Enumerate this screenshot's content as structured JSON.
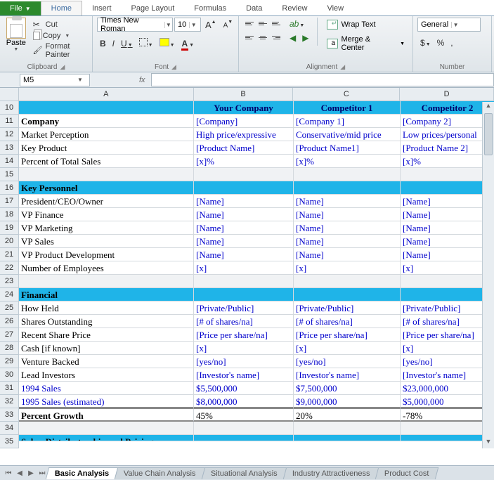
{
  "tabs": {
    "file": "File",
    "list": [
      "Home",
      "Insert",
      "Page Layout",
      "Formulas",
      "Data",
      "Review",
      "View"
    ],
    "active": 0
  },
  "clipboard": {
    "paste": "Paste",
    "cut": "Cut",
    "copy": "Copy",
    "painter": "Format Painter",
    "group": "Clipboard"
  },
  "font": {
    "name": "Times New Roman",
    "size": "10",
    "group": "Font",
    "btns": {
      "grow": "A",
      "shrink": "A",
      "bold": "B",
      "italic": "I",
      "underline": "U",
      "fontcolor": "A"
    }
  },
  "alignment": {
    "group": "Alignment",
    "wrap": "Wrap Text",
    "merge": "Merge & Center"
  },
  "number": {
    "group": "Number",
    "format": "General",
    "currency": "$",
    "percent": "%",
    "comma": ",",
    "inc": "",
    "dec": ""
  },
  "namebox": "M5",
  "fx": "fx",
  "columns": [
    "A",
    "B",
    "C",
    "D"
  ],
  "rowStart": 10,
  "headers": {
    "A": "",
    "B": "Your Company",
    "C": "Competitor 1",
    "D": "Competitor 2"
  },
  "rows": [
    {
      "n": 11,
      "type": "data",
      "bold": true,
      "a": "Company",
      "b": "[Company]",
      "c": "[Company 1]",
      "d": "[Company 2]"
    },
    {
      "n": 12,
      "type": "data",
      "a": "Market Perception",
      "b": "High price/expressive",
      "c": "Conservative/mid price",
      "d": "Low prices/personal"
    },
    {
      "n": 13,
      "type": "data",
      "a": "Key Product",
      "b": "[Product Name]",
      "c": "[Product Name1]",
      "d": "[Product Name 2]"
    },
    {
      "n": 14,
      "type": "data",
      "a": "Percent of Total Sales",
      "b": "[x]%",
      "c": "[x]%",
      "d": "[x]%"
    },
    {
      "n": 15,
      "type": "blank"
    },
    {
      "n": 16,
      "type": "section",
      "a": "Key Personnel"
    },
    {
      "n": 17,
      "type": "data",
      "a": "President/CEO/Owner",
      "b": "[Name]",
      "c": "[Name]",
      "d": "[Name]"
    },
    {
      "n": 18,
      "type": "data",
      "a": "VP Finance",
      "b": "[Name]",
      "c": "[Name]",
      "d": "[Name]"
    },
    {
      "n": 19,
      "type": "data",
      "a": "VP Marketing",
      "b": "[Name]",
      "c": "[Name]",
      "d": "[Name]"
    },
    {
      "n": 20,
      "type": "data",
      "a": "VP Sales",
      "b": "[Name]",
      "c": "[Name]",
      "d": "[Name]"
    },
    {
      "n": 21,
      "type": "data",
      "a": "VP Product Development",
      "b": "[Name]",
      "c": "[Name]",
      "d": "[Name]"
    },
    {
      "n": 22,
      "type": "data",
      "a": "Number of Employees",
      "b": "[x]",
      "c": "[x]",
      "d": "[x]"
    },
    {
      "n": 23,
      "type": "blank"
    },
    {
      "n": 24,
      "type": "section",
      "a": "Financial"
    },
    {
      "n": 25,
      "type": "data",
      "a": "How Held",
      "b": "[Private/Public]",
      "c": "[Private/Public]",
      "d": "[Private/Public]"
    },
    {
      "n": 26,
      "type": "data",
      "a": "Shares Outstanding",
      "b": "[# of shares/na]",
      "c": "[# of shares/na]",
      "d": "[# of shares/na]"
    },
    {
      "n": 27,
      "type": "data",
      "a": "Recent Share Price",
      "b": "[Price per share/na]",
      "c": "[Price per share/na]",
      "d": "[Price per share/na]"
    },
    {
      "n": 28,
      "type": "data",
      "a": "Cash [if known]",
      "b": "[x]",
      "c": "[x]",
      "d": "[x]"
    },
    {
      "n": 29,
      "type": "data",
      "a": "Venture Backed",
      "b": "[yes/no]",
      "c": "[yes/no]",
      "d": "[yes/no]"
    },
    {
      "n": 30,
      "type": "data",
      "a": "Lead Investors",
      "b": "[Investor's name]",
      "c": "[Investor's name]",
      "d": "[Investor's name]"
    },
    {
      "n": 31,
      "type": "data",
      "link": true,
      "a": "1994 Sales",
      "b": "$5,500,000",
      "c": "$7,500,000",
      "d": "$23,000,000"
    },
    {
      "n": 32,
      "type": "data",
      "link": true,
      "a": "1995 Sales (estimated)",
      "b": "$8,000,000",
      "c": "$9,000,000",
      "d": "$5,000,000",
      "bottomthick": true
    },
    {
      "n": 33,
      "type": "data",
      "bold": true,
      "a": "Percent Growth",
      "b": "45%",
      "c": "20%",
      "d": "-78%",
      "black": true,
      "topthick": true,
      "bottomthick": true
    },
    {
      "n": 34,
      "type": "blank"
    },
    {
      "n": 35,
      "type": "section-cut",
      "a": "Sales, Distributorship and Pricing"
    }
  ],
  "sheets": {
    "list": [
      "Basic Analysis",
      "Value Chain Analysis",
      "Situational Analysis",
      "Industry Attractiveness",
      "Product Cost"
    ],
    "active": 0
  }
}
